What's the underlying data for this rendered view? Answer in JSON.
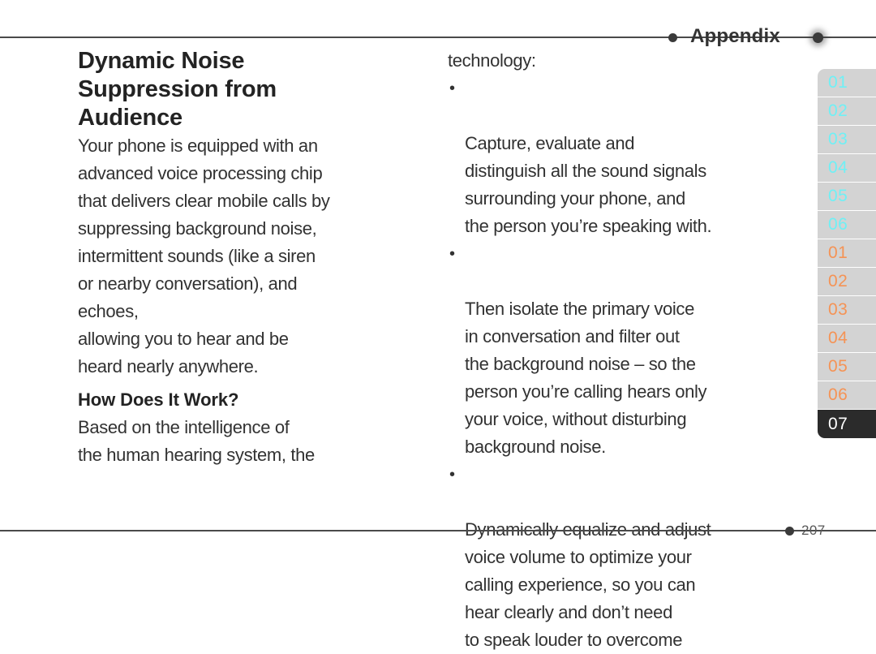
{
  "header": {
    "title": "Appendix",
    "dot_left_icon": "bullet-dot-icon",
    "dot_right_icon": "bullet-dot-glow-icon"
  },
  "footer": {
    "page_number": "207",
    "dot_icon": "bullet-dot-icon"
  },
  "article": {
    "title": "Dynamic Noise\nSuppression from\nAudience",
    "intro": "Your phone is equipped with an\nadvanced voice processing chip\nthat delivers clear mobile calls by\nsuppressing background noise,\nintermittent sounds (like a siren\nor nearby conversation), and\nechoes,",
    "intro_continued": "allowing you to hear and be\nheard nearly anywhere.",
    "subheading": "How Does It Work?",
    "subheading_body": "Based on the intelligence of\nthe human hearing system, the",
    "right_column_lead": "technology:",
    "bullets": [
      {
        "marker": "•",
        "text": "Capture, evaluate and\ndistinguish all the sound signals\nsurrounding your phone, and\nthe person you’re speaking with."
      },
      {
        "marker": "•",
        "text": "Then isolate the primary voice\nin conversation and filter out\nthe background noise – so the\nperson you’re calling hears only\nyour voice, without disturbing\nbackground noise."
      },
      {
        "marker": "•",
        "text": "Dynamically equalize and adjust\nvoice volume to optimize your\ncalling experience, so you can\nhear clearly and don’t need\nto speak louder to overcome"
      }
    ]
  },
  "side_tabs": {
    "items": [
      {
        "label": "01",
        "group": "a",
        "active": false
      },
      {
        "label": "02",
        "group": "a",
        "active": false
      },
      {
        "label": "03",
        "group": "a",
        "active": false
      },
      {
        "label": "04",
        "group": "a",
        "active": false
      },
      {
        "label": "05",
        "group": "a",
        "active": false
      },
      {
        "label": "06",
        "group": "a",
        "active": false
      },
      {
        "label": "01",
        "group": "b",
        "active": false
      },
      {
        "label": "02",
        "group": "b",
        "active": false
      },
      {
        "label": "03",
        "group": "b",
        "active": false
      },
      {
        "label": "04",
        "group": "b",
        "active": false
      },
      {
        "label": "05",
        "group": "b",
        "active": false
      },
      {
        "label": "06",
        "group": "b",
        "active": false
      },
      {
        "label": "07",
        "group": "b",
        "active": true
      }
    ]
  },
  "colors": {
    "rule": "#4a4a4a",
    "tab_background": "#d3d3d3",
    "tab_group_a_text": "#6ff0f5",
    "tab_group_b_text": "#f59355",
    "tab_active_background": "#2b2b2b",
    "tab_active_text": "#ffffff",
    "body_text": "#323232",
    "heading_text": "#232323"
  }
}
